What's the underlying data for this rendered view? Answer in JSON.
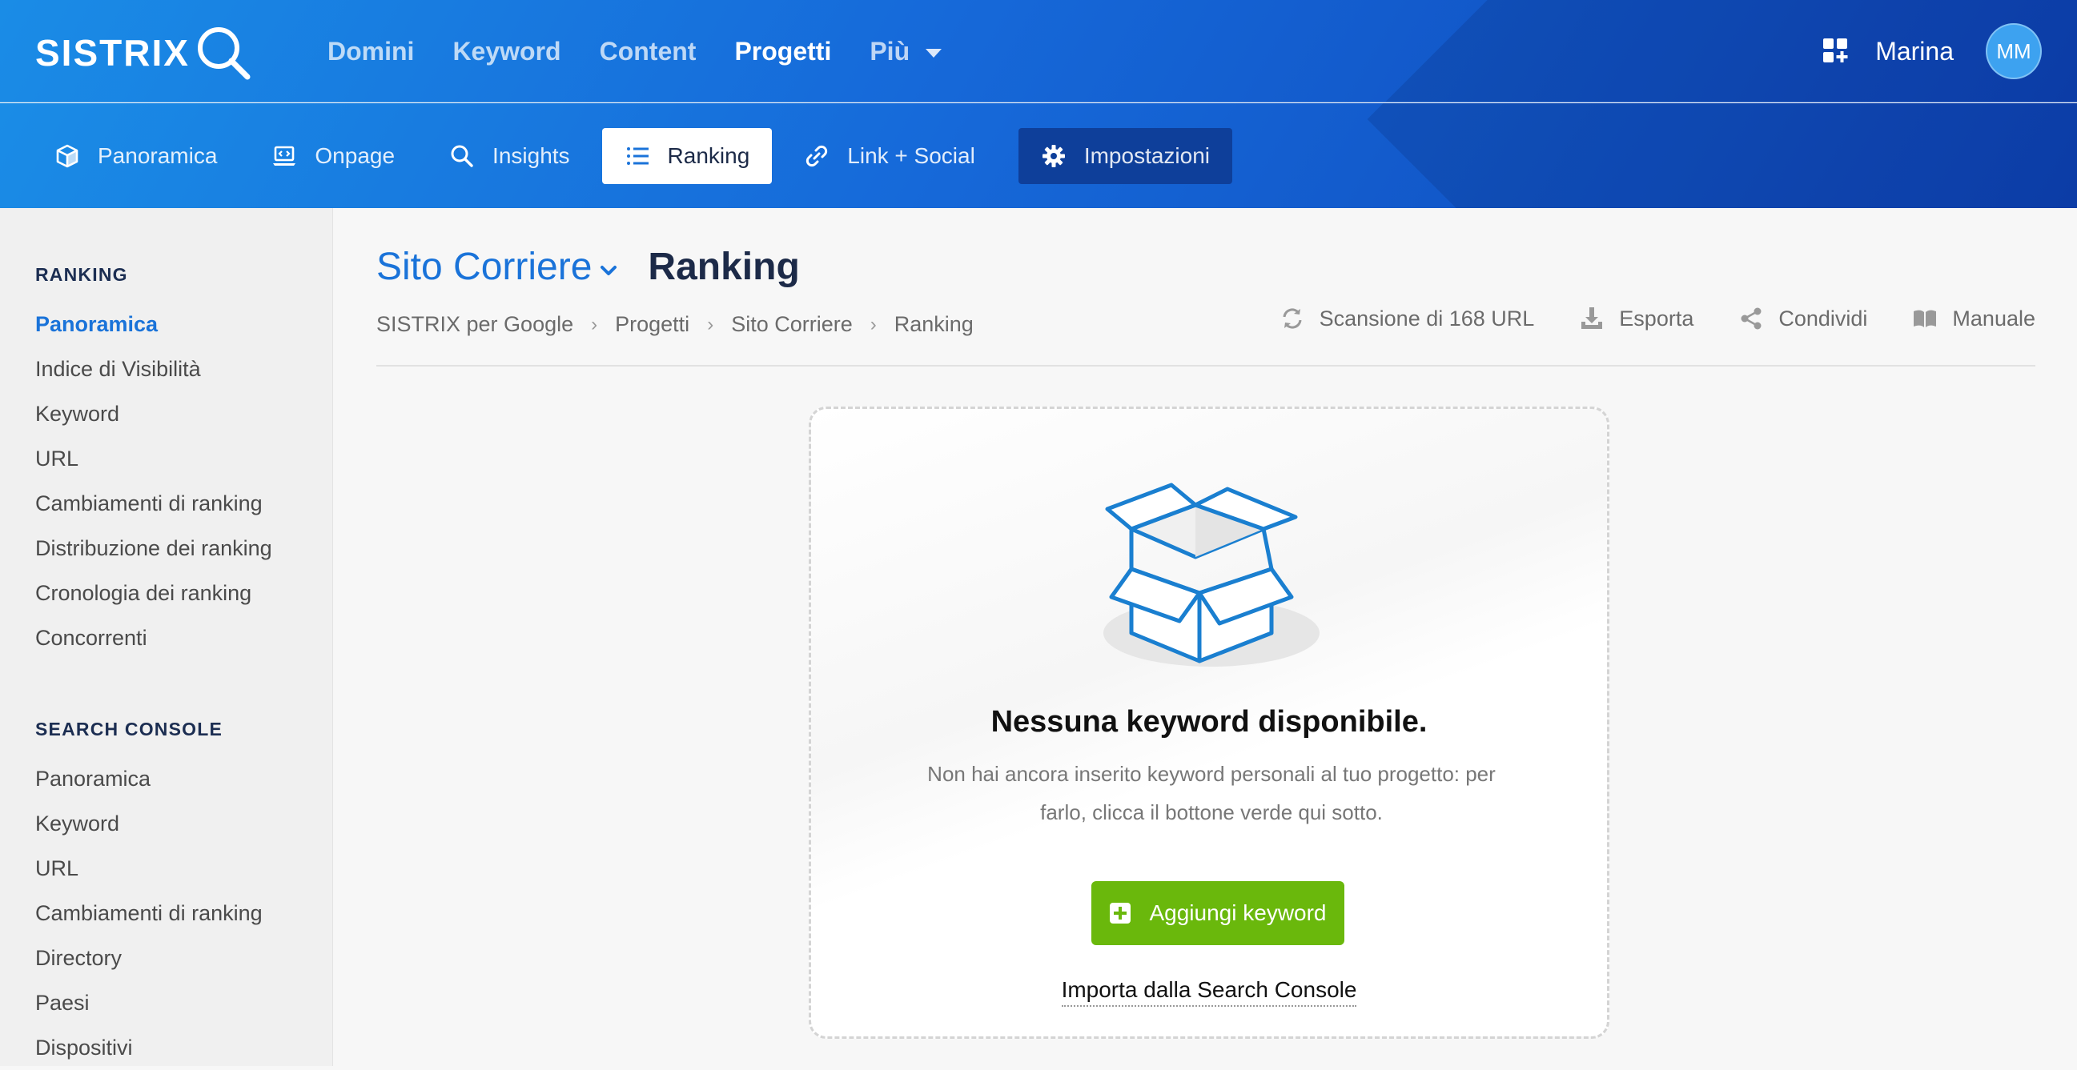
{
  "brand": {
    "name": "SISTRIX"
  },
  "main_nav": {
    "items": [
      {
        "label": "Domini"
      },
      {
        "label": "Keyword"
      },
      {
        "label": "Content"
      },
      {
        "label": "Progetti"
      },
      {
        "label": "Più"
      }
    ],
    "active": "Progetti"
  },
  "user": {
    "name": "Marina",
    "initials": "MM"
  },
  "sub_nav": {
    "items": [
      {
        "label": "Panoramica",
        "icon": "cube-icon"
      },
      {
        "label": "Onpage",
        "icon": "laptop-code-icon"
      },
      {
        "label": "Insights",
        "icon": "search-icon"
      },
      {
        "label": "Ranking",
        "icon": "list-icon"
      },
      {
        "label": "Link + Social",
        "icon": "link-icon"
      },
      {
        "label": "Impostazioni",
        "icon": "gear-icon"
      }
    ],
    "active": "Ranking"
  },
  "sidebar": {
    "ranking": {
      "heading": "RANKING",
      "items": [
        {
          "label": "Panoramica"
        },
        {
          "label": "Indice di Visibilità"
        },
        {
          "label": "Keyword"
        },
        {
          "label": "URL"
        },
        {
          "label": "Cambiamenti di ranking"
        },
        {
          "label": "Distribuzione dei ranking"
        },
        {
          "label": "Cronologia dei ranking"
        },
        {
          "label": "Concorrenti"
        }
      ],
      "active": "Panoramica"
    },
    "search_console": {
      "heading": "SEARCH CONSOLE",
      "items": [
        {
          "label": "Panoramica"
        },
        {
          "label": "Keyword"
        },
        {
          "label": "URL"
        },
        {
          "label": "Cambiamenti di ranking"
        },
        {
          "label": "Directory"
        },
        {
          "label": "Paesi"
        },
        {
          "label": "Dispositivi"
        }
      ]
    }
  },
  "header": {
    "project_name": "Sito Corriere",
    "page_title": "Ranking",
    "breadcrumb": [
      {
        "label": "SISTRIX per Google"
      },
      {
        "label": "Progetti"
      },
      {
        "label": "Sito Corriere"
      },
      {
        "label": "Ranking"
      }
    ],
    "breadcrumb_separator": "›",
    "actions": {
      "scan": "Scansione di 168 URL",
      "export": "Esporta",
      "share": "Condividi",
      "manual": "Manuale"
    }
  },
  "empty_state": {
    "title": "Nessuna keyword disponibile.",
    "description_line1": "Non hai ancora inserito keyword personali al tuo progetto: per",
    "description_line2": "farlo, clicca il bottone verde qui sotto.",
    "add_button": "Aggiungi keyword",
    "import_link": "Importa dalla Search Console"
  },
  "colors": {
    "accent_blue": "#1a73d9",
    "add_green": "#6ab80c",
    "box_line_blue": "#1a7fd0"
  }
}
